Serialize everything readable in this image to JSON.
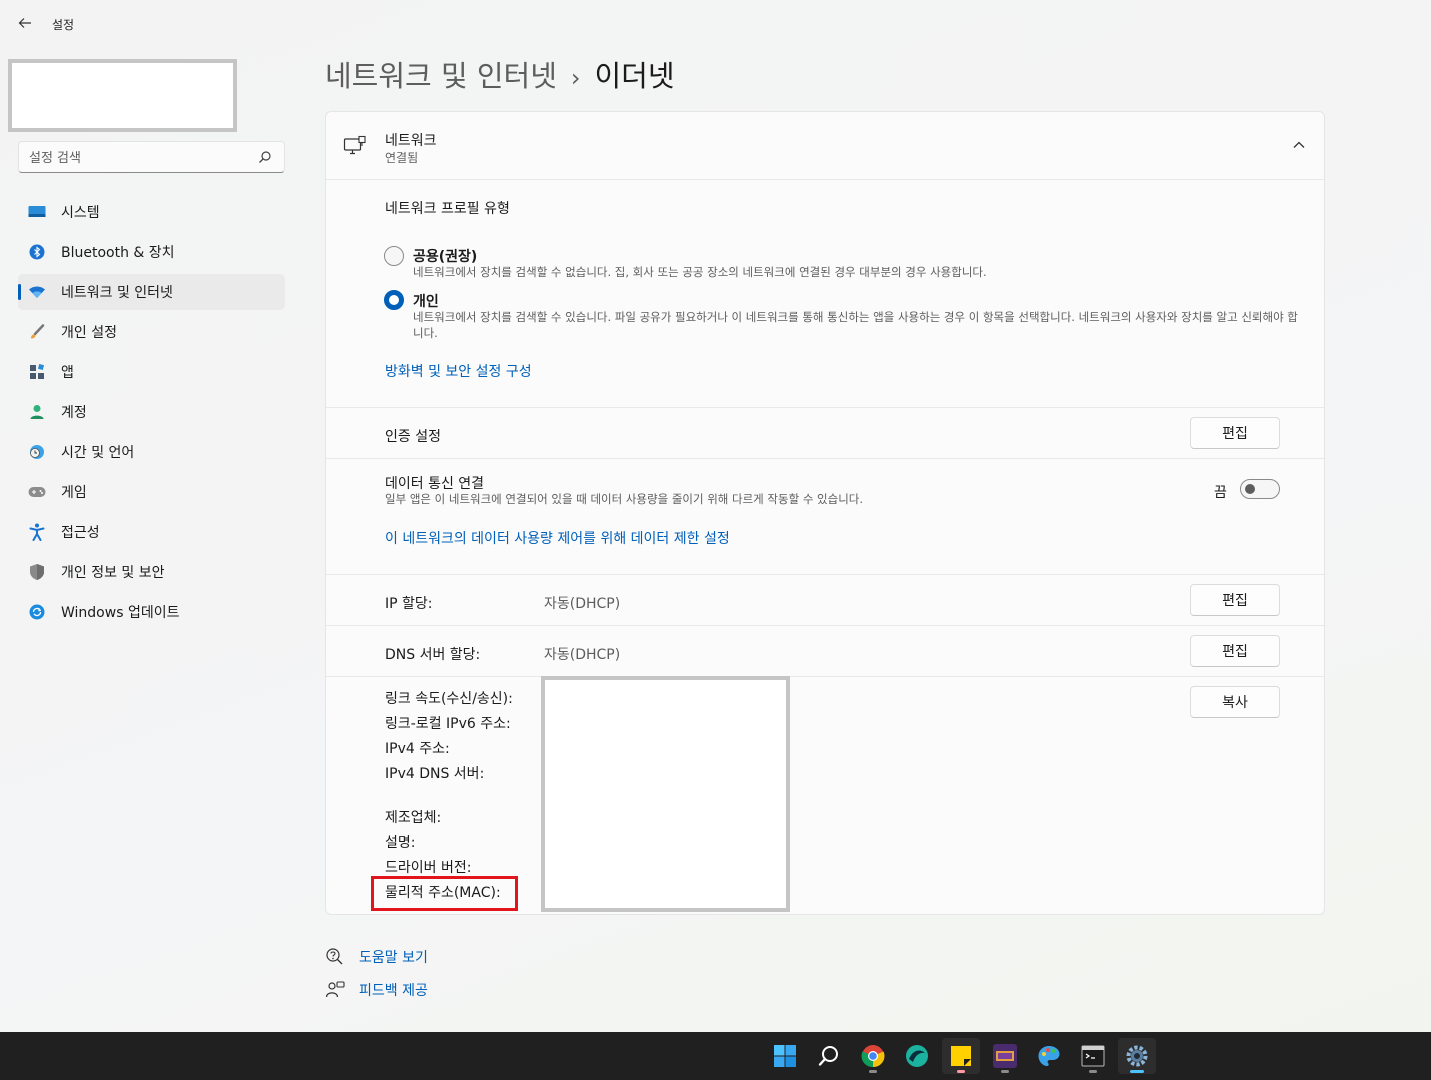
{
  "window": {
    "app_title": "설정",
    "back_icon": "back-arrow-icon"
  },
  "sidebar": {
    "search_placeholder": "설정 검색",
    "items": [
      {
        "label": "시스템",
        "icon": "system-icon"
      },
      {
        "label": "Bluetooth & 장치",
        "icon": "bluetooth-icon"
      },
      {
        "label": "네트워크 및 인터넷",
        "icon": "network-wifi-icon",
        "active": true
      },
      {
        "label": "개인 설정",
        "icon": "personalization-brush-icon"
      },
      {
        "label": "앱",
        "icon": "apps-icon"
      },
      {
        "label": "계정",
        "icon": "account-icon"
      },
      {
        "label": "시간 및 언어",
        "icon": "time-language-icon"
      },
      {
        "label": "게임",
        "icon": "gaming-icon"
      },
      {
        "label": "접근성",
        "icon": "accessibility-icon"
      },
      {
        "label": "개인 정보 및 보안",
        "icon": "privacy-shield-icon"
      },
      {
        "label": "Windows 업데이트",
        "icon": "windows-update-icon"
      }
    ]
  },
  "breadcrumb": {
    "parent": "네트워크 및 인터넷",
    "separator": "›",
    "current": "이더넷"
  },
  "network_card": {
    "name": "네트워크",
    "status": "연결됨",
    "profile_section_title": "네트워크 프로필 유형",
    "profile_options": [
      {
        "label": "공용(권장)",
        "description": "네트워크에서 장치를 검색할 수 없습니다. 집, 회사 또는 공공 장소의 네트워크에 연결된 경우 대부분의 경우 사용합니다.",
        "selected": false
      },
      {
        "label": "개인",
        "description": "네트워크에서 장치를 검색할 수 있습니다. 파일 공유가 필요하거나 이 네트워크를 통해 통신하는 앱을 사용하는 경우 이 항목을 선택합니다. 네트워크의 사용자와 장치를 알고 신뢰해야 합니다.",
        "selected": true
      }
    ],
    "firewall_link": "방화벽 및 보안 설정 구성",
    "auth": {
      "label": "인증 설정",
      "button": "편집"
    },
    "metered": {
      "label": "데이터 통신 연결",
      "description": "일부 앱은 이 네트워크에 연결되어 있을 때 데이터 사용량을 줄이기 위해 다르게 작동할 수 있습니다.",
      "toggle_text": "끔",
      "toggle_on": false,
      "data_limit_link": "이 네트워크의 데이터 사용량 제어를 위해 데이터 제한 설정"
    },
    "ip_assignment": {
      "label": "IP 할당:",
      "value": "자동(DHCP)",
      "button": "편집"
    },
    "dns_assignment": {
      "label": "DNS 서버 할당:",
      "value": "자동(DHCP)",
      "button": "편집"
    },
    "properties": {
      "copy_button": "복사",
      "labels": [
        "링크 속도(수신/송신):",
        "링크-로컬 IPv6 주소:",
        "IPv4 주소:",
        "IPv4 DNS 서버:",
        "제조업체:",
        "설명:",
        "드라이버 버전:",
        "물리적 주소(MAC):"
      ]
    }
  },
  "help": {
    "get_help": "도움말 보기",
    "feedback": "피드백 제공"
  },
  "taskbar": {
    "items": [
      {
        "name": "start-windows-icon"
      },
      {
        "name": "search-icon"
      },
      {
        "name": "chrome-icon"
      },
      {
        "name": "app-swirl-icon"
      },
      {
        "name": "sticky-notes-icon",
        "alert": true
      },
      {
        "name": "game-app-icon"
      },
      {
        "name": "paint-palette-icon"
      },
      {
        "name": "terminal-icon"
      },
      {
        "name": "settings-gear-icon",
        "current": true
      }
    ]
  },
  "colors": {
    "accent": "#005fb8",
    "highlight_red": "#e2151c",
    "taskbar_bg": "#202020"
  }
}
